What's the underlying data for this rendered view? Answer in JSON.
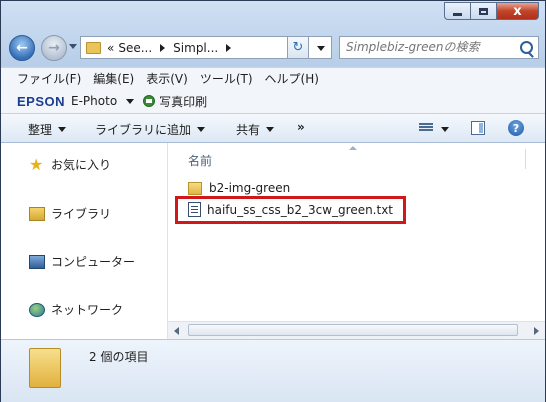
{
  "window": {
    "caption_buttons": [
      "minimize",
      "maximize",
      "close"
    ],
    "close_glyph": "x"
  },
  "address": {
    "back_icon": "back-arrow-icon",
    "forward_icon": "forward-arrow-icon",
    "crumb_overflow": "«",
    "crumb_1": "See...",
    "crumb_2": "Simpl...",
    "refresh_glyph": "↻",
    "search_placeholder": "Simplebiz-greenの検索"
  },
  "menubar": {
    "items": [
      "ファイル(F)",
      "編集(E)",
      "表示(V)",
      "ツール(T)",
      "ヘルプ(H)"
    ]
  },
  "epson": {
    "brand": "EPSON",
    "product": "E-Photo",
    "print_label": "写真印刷"
  },
  "toolbar": {
    "organize": "整理",
    "add_to_library": "ライブラリに追加",
    "share": "共有",
    "overflow": "»",
    "help_glyph": "?"
  },
  "nav": {
    "favorites": "お気に入り",
    "libraries": "ライブラリ",
    "computer": "コンピューター",
    "network": "ネットワーク"
  },
  "content": {
    "column_name": "名前",
    "files": [
      {
        "name": "b2-img-green",
        "type": "folder"
      },
      {
        "name": "haifu_ss_css_b2_3cw_green.txt",
        "type": "text"
      }
    ]
  },
  "status": {
    "item_count": "2 個の項目"
  },
  "colors": {
    "highlight": "#d11818",
    "title_bar": "#b9cfe9"
  }
}
